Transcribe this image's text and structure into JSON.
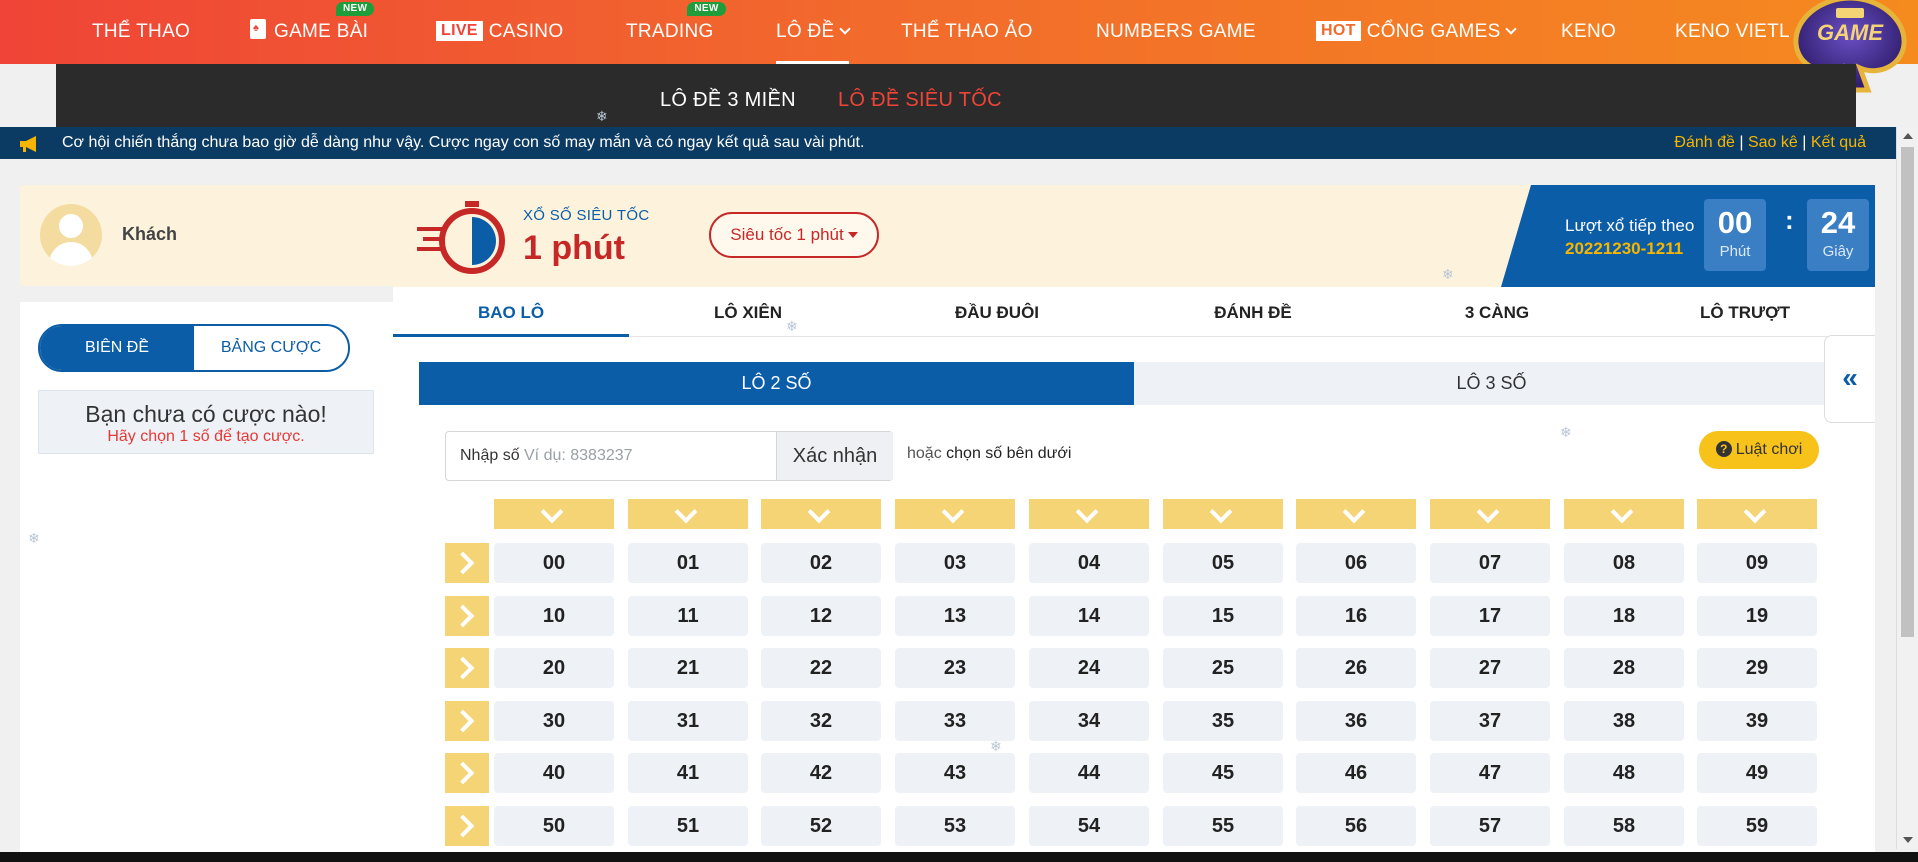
{
  "nav": {
    "items": [
      {
        "label": "THỂ THAO"
      },
      {
        "label": "GAME BÀI",
        "badge": "NEW"
      },
      {
        "tag": "LIVE",
        "label": "CASINO"
      },
      {
        "label": "TRADING",
        "badge": "NEW"
      },
      {
        "label": "LÔ ĐỀ"
      },
      {
        "label": "THỂ THAO ẢO"
      },
      {
        "label": "NUMBERS GAME"
      },
      {
        "tag": "HOT",
        "label": "CỔNG GAMES"
      },
      {
        "label": "KENO"
      },
      {
        "label": "KENO VIETL"
      }
    ],
    "logo_text": "GAME"
  },
  "subnav": {
    "items": [
      {
        "label": "LÔ ĐỀ 3 MIỀN"
      },
      {
        "label": "LÔ ĐỀ SIÊU TỐC"
      }
    ]
  },
  "marquee": {
    "text": "Cơ hội chiến thắng chưa bao giờ dễ dàng như vậy. Cược ngay con số may mắn và có ngay kết quả sau vài phút.",
    "links": [
      "Đánh đề",
      "Sao kê",
      "Kết quả"
    ],
    "separator": "|"
  },
  "user": {
    "name": "Khách"
  },
  "betslip": {
    "tabs": [
      "BIÊN ĐỀ",
      "BẢNG CƯỢC"
    ],
    "empty_title": "Bạn chưa có cược nào!",
    "empty_sub": "Hãy chọn 1 số để tạo cược."
  },
  "game": {
    "small_title": "XỔ SỐ SIÊU TỐC",
    "big_title": "1 phút",
    "period_select": "Siêu tốc 1 phút",
    "next_draw_label": "Lượt xổ tiếp theo",
    "next_draw_code": "20221230-1211",
    "countdown": {
      "minutes": "00",
      "minutes_unit": "Phút",
      "seconds": "24",
      "seconds_unit": "Giây",
      "colon": ":"
    }
  },
  "tabs": [
    "BAO LÔ",
    "LÔ XIÊN",
    "ĐẦU ĐUÔI",
    "ĐÁNH ĐỀ",
    "3 CÀNG",
    "LÔ TRƯỢT"
  ],
  "subtabs": [
    "LÔ 2 SỐ",
    "LÔ 3 SỐ"
  ],
  "number_input": {
    "label": "Nhập số",
    "placeholder": "Ví dụ: 8383237",
    "confirm": "Xác nhận",
    "or_text": "hoặc",
    "or_bold": "chọn số bên dưới"
  },
  "rules_button": "Luật chơi",
  "numbers": [
    [
      "00",
      "01",
      "02",
      "03",
      "04",
      "05",
      "06",
      "07",
      "08",
      "09"
    ],
    [
      "10",
      "11",
      "12",
      "13",
      "14",
      "15",
      "16",
      "17",
      "18",
      "19"
    ],
    [
      "20",
      "21",
      "22",
      "23",
      "24",
      "25",
      "26",
      "27",
      "28",
      "29"
    ],
    [
      "30",
      "31",
      "32",
      "33",
      "34",
      "35",
      "36",
      "37",
      "38",
      "39"
    ],
    [
      "40",
      "41",
      "42",
      "43",
      "44",
      "45",
      "46",
      "47",
      "48",
      "49"
    ],
    [
      "50",
      "51",
      "52",
      "53",
      "54",
      "55",
      "56",
      "57",
      "58",
      "59"
    ]
  ],
  "side_toggle": "«",
  "colors": {
    "brand_blue": "#0b5da8",
    "accent_red": "#c62828",
    "gold": "#f7b500",
    "nav_orange": "#f26a2c"
  }
}
